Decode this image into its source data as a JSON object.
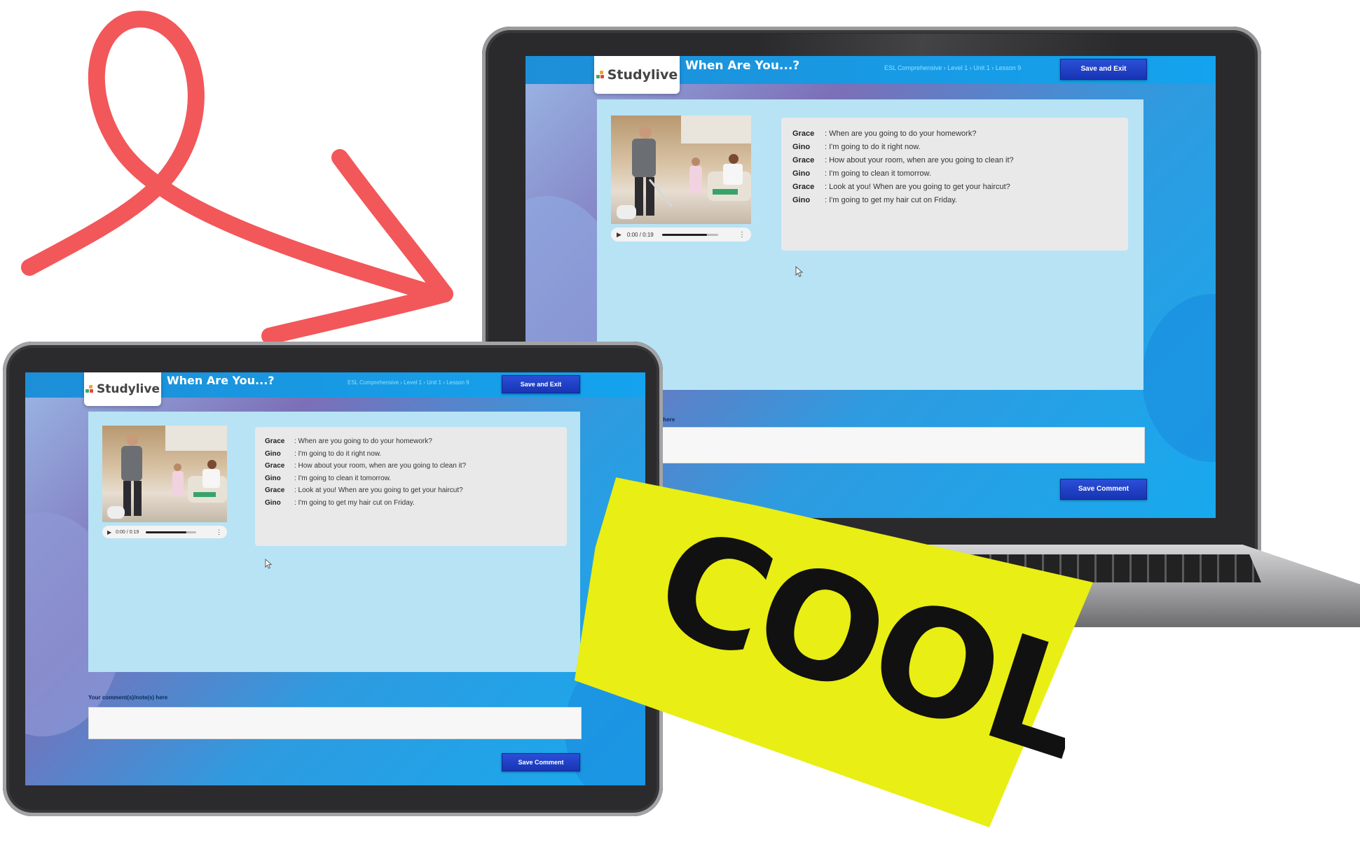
{
  "app": {
    "logo_text": "Studylive",
    "lesson_title": "When Are You...?",
    "breadcrumb": "ESL Comprehensive  ›  Level 1  ›  Unit 1  ›  Lesson 9",
    "save_exit_label": "Save and Exit",
    "audio_time": "0:00 / 0:19",
    "audio_progress": 0.8,
    "comment_label": "Your comment(s)/note(s) here",
    "save_comment_label": "Save Comment"
  },
  "dialogue": [
    {
      "speaker": "Grace",
      "text": ": When are you going to do your homework?"
    },
    {
      "speaker": "Gino",
      "text": ": I'm going to do it right now."
    },
    {
      "speaker": "Grace",
      "text": ": How about your room, when are you going to clean it?"
    },
    {
      "speaker": "Gino",
      "text": ": I'm going to clean it tomorrow."
    },
    {
      "speaker": "Grace",
      "text": ": Look at you! When are you going to get your haircut?"
    },
    {
      "speaker": "Gino",
      "text": ": I'm going to get my hair cut on Friday."
    }
  ],
  "sticker": {
    "text": "COOL"
  },
  "colors": {
    "accent_arrow": "#f2575a",
    "sticker_yellow": "#e9ee14",
    "button_blue": "#1f3fc8",
    "content_bg": "#b7e3f5"
  },
  "icons": [
    "play-icon",
    "more-options-icon",
    "logo-mark-icon",
    "mouse-cursor-icon",
    "curly-arrow-icon"
  ]
}
